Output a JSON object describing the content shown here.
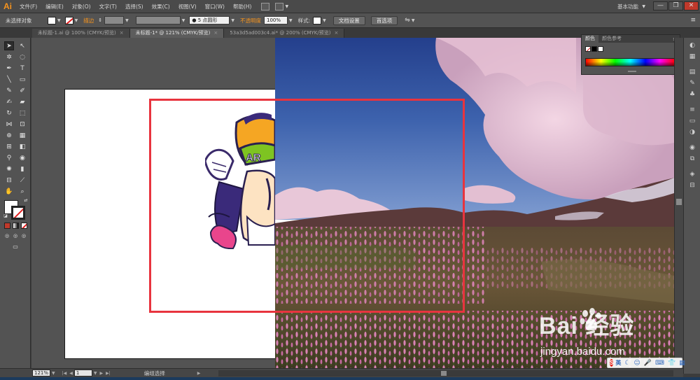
{
  "app": {
    "logo": "Ai",
    "menu": [
      "文件(F)",
      "编辑(E)",
      "对象(O)",
      "文字(T)",
      "选择(S)",
      "效果(C)",
      "视图(V)",
      "窗口(W)",
      "帮助(H)"
    ],
    "workspace": "基本功能",
    "window_buttons": [
      "—",
      "❐",
      "✕"
    ]
  },
  "control_bar": {
    "selection_status": "未选择对象",
    "stroke_label": "描边",
    "brush_value": "5 点圆形",
    "opacity_label": "不透明度",
    "opacity_value": "100%",
    "style_label": "样式",
    "doc_setup_button": "文档设置",
    "preferences_button": "首选项"
  },
  "tabs": [
    {
      "label": "未标题-1.ai @ 100% (CMYK/预览)",
      "active": false
    },
    {
      "label": "未标题-1* @ 121% (CMYK/预览)",
      "active": true
    },
    {
      "label": "53a3d5ad003c4.ai* @ 200% (CMYK/预览)",
      "active": false
    }
  ],
  "color_panel": {
    "tabs": [
      "颜色",
      "颜色参考"
    ]
  },
  "status_bar": {
    "zoom": "121%",
    "page": "1",
    "tool_status": "编组选择"
  },
  "watermark": {
    "brand": "Bai  经验",
    "url": "jingyan.baidu.com"
  },
  "ime": {
    "logo": "S",
    "mode": "英"
  },
  "colors": {
    "accent": "#f7941d",
    "selection_rect": "#e8343e",
    "panel_bg": "#535353"
  }
}
